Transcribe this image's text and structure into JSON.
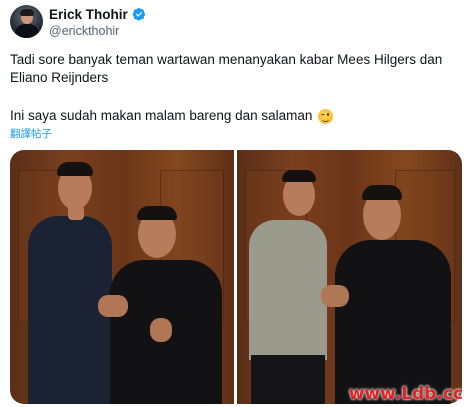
{
  "author": {
    "display_name": "Erick Thohir",
    "handle": "@erickthohir",
    "verified": true
  },
  "tweet": {
    "line1": "Tadi sore banyak teman wartawan menanyakan kabar Mees Hilgers dan",
    "line2": "Eliano Reijnders",
    "line3": "Ini saya sudah makan malam bareng dan salaman",
    "emoji": "winking-face"
  },
  "translate_label": "翻譯帖子",
  "watermark": "www.Ldb.cc",
  "colors": {
    "accent": "#1d9bf0",
    "text": "#0f1419",
    "secondary": "#536471",
    "watermark": "#e12222"
  }
}
